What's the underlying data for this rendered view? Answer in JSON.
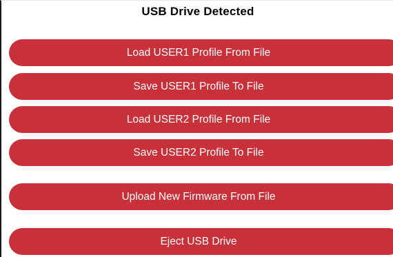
{
  "header": {
    "title": "USB Drive Detected"
  },
  "buttons": {
    "load_user1": "Load USER1 Profile From File",
    "save_user1": "Save USER1 Profile To File",
    "load_user2": "Load USER2 Profile From File",
    "save_user2": "Save USER2 Profile To File",
    "upload_firmware": "Upload New Firmware From File",
    "eject": "Eject USB Drive"
  },
  "colors": {
    "button_bg": "#c8303a",
    "button_text": "#ffffff",
    "title_text": "#000000"
  }
}
